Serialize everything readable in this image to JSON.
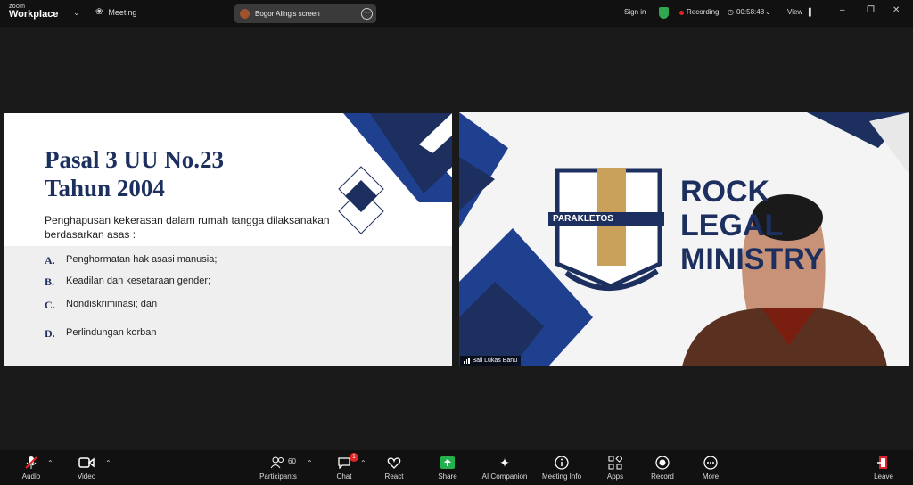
{
  "app": {
    "brand_top": "zoom",
    "brand_bottom": "Workplace",
    "meeting_label": "Meeting"
  },
  "share": {
    "label": "Bogor Aling's screen"
  },
  "header": {
    "sign_in": "Sign in",
    "recording": "Recording",
    "timer": "00:58:48",
    "view": "View"
  },
  "slide": {
    "title_line1": "Pasal 3 UU No.23",
    "title_line2": "Tahun 2004",
    "intro": "Penghapusan kekerasan dalam rumah tangga dilaksanakan berdasarkan asas :",
    "items": [
      {
        "letter": "A.",
        "text": "Penghormatan hak asasi manusia;"
      },
      {
        "letter": "B.",
        "text": "Keadilan dan kesetaraan gender;"
      },
      {
        "letter": "C.",
        "text": "Nondiskriminasi; dan"
      },
      {
        "letter": "D.",
        "text": "Perlindungan korban"
      }
    ]
  },
  "video": {
    "participant_name": "Bali Lukas Banu",
    "banner_logo_text": "PARAKLETOS",
    "banner_line1": "ROCK",
    "banner_line2": "LEGAL",
    "banner_line3": "MINISTRY"
  },
  "toolbar": {
    "audio": "Audio",
    "video": "Video",
    "participants": "Participants",
    "participants_count": "60",
    "chat": "Chat",
    "chat_badge": "1",
    "react": "React",
    "share": "Share",
    "ai_companion": "AI Companion",
    "meeting_info": "Meeting Info",
    "apps": "Apps",
    "record": "Record",
    "more": "More",
    "leave": "Leave"
  },
  "colors": {
    "accent_navy": "#1c2f5e",
    "share_green": "#23b14d",
    "recording_red": "#e02424",
    "leave_red": "#d9232e"
  }
}
